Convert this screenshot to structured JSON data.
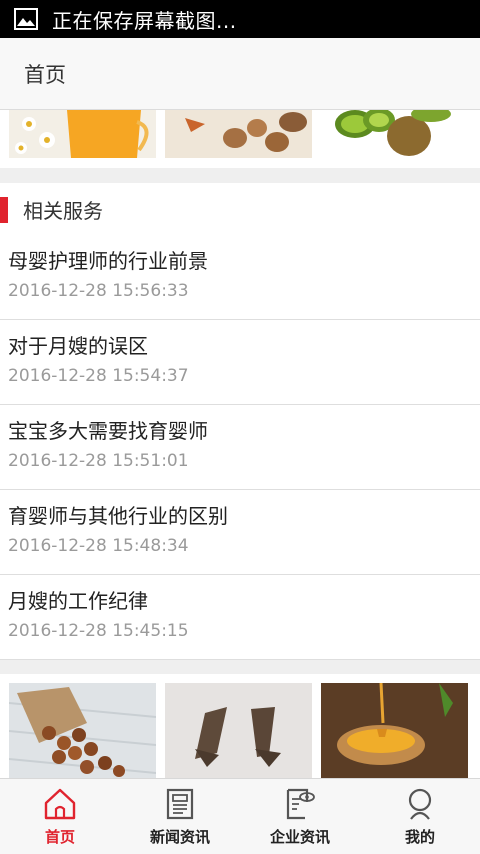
{
  "status_bar": {
    "text": "正在保存屏幕截图..."
  },
  "header": {
    "title": "首页"
  },
  "section": {
    "title": "相关服务",
    "items": [
      {
        "title": "母婴护理师的行业前景",
        "date": "2016-12-28 15:56:33"
      },
      {
        "title": "对于月嫂的误区",
        "date": "2016-12-28 15:54:37"
      },
      {
        "title": "宝宝多大需要找育婴师",
        "date": "2016-12-28 15:51:01"
      },
      {
        "title": "育婴师与其他行业的区别",
        "date": "2016-12-28 15:48:34"
      },
      {
        "title": "月嫂的工作纪律",
        "date": "2016-12-28 15:45:15"
      }
    ]
  },
  "tabs": [
    {
      "label": "首页",
      "icon": "home-icon",
      "active": true
    },
    {
      "label": "新闻资讯",
      "icon": "newspaper-icon",
      "active": false
    },
    {
      "label": "企业资讯",
      "icon": "document-eye-icon",
      "active": false
    },
    {
      "label": "我的",
      "icon": "user-icon",
      "active": false
    }
  ],
  "colors": {
    "accent": "#e0232e",
    "status_bar": "#000000",
    "header_bg": "#f8f8f8"
  }
}
